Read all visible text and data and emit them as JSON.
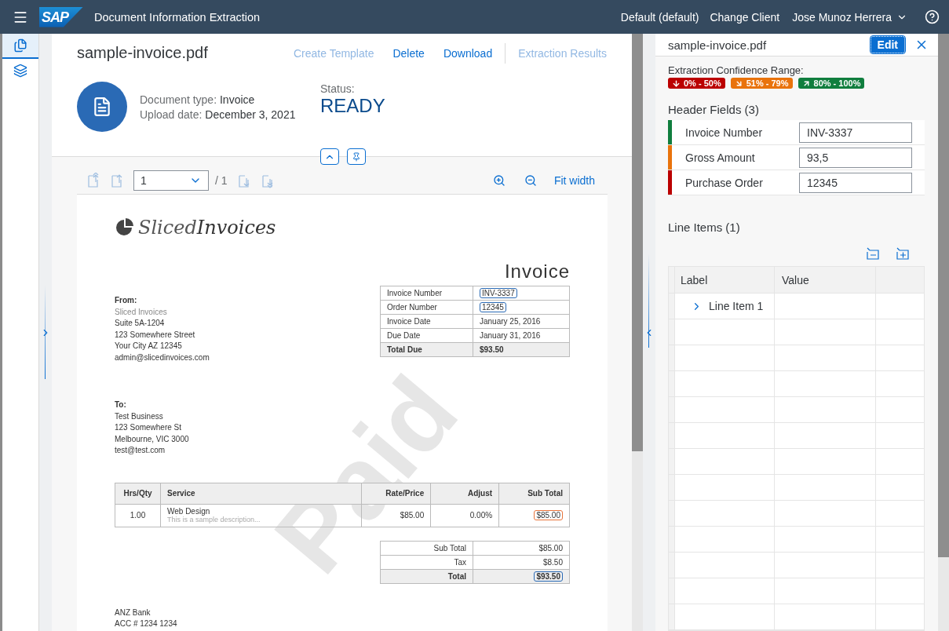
{
  "shell": {
    "logo": "SAP",
    "title": "Document Information Extraction",
    "client": "Default (default)",
    "change_client": "Change Client",
    "user": "Jose Munoz Herrera"
  },
  "rail": {
    "items": [
      {
        "kind": "documents",
        "selected": true
      },
      {
        "kind": "schemas",
        "selected": false
      }
    ]
  },
  "document": {
    "title": "sample-invoice.pdf",
    "actions": [
      {
        "label": "Create Template",
        "disabled": true
      },
      {
        "label": "Delete",
        "disabled": false
      },
      {
        "label": "Download",
        "disabled": false
      },
      {
        "label": "Extraction Results",
        "disabled": true
      }
    ],
    "doc_type_label": "Document type:",
    "doc_type": "Invoice",
    "upload_label": "Upload date:",
    "upload_date": "December 3, 2021",
    "status_label": "Status:",
    "status": "READY"
  },
  "viewer": {
    "page": "1",
    "page_count": "/ 1",
    "fit": "Fit width"
  },
  "pdf": {
    "brand_a": "Sliced",
    "brand_b": "Invoices",
    "heading": "Invoice",
    "from": {
      "label": "From:",
      "lines": [
        "Sliced Invoices",
        "Suite 5A-1204",
        "123 Somewhere Street",
        "Your City AZ 12345",
        "admin@slicedinvoices.com"
      ]
    },
    "meta": [
      {
        "label": "Invoice Number",
        "value": "INV-3337",
        "color": "#2a6ab5",
        "bold": false
      },
      {
        "label": "Order Number",
        "value": "12345",
        "color": "#2a6ab5",
        "bold": false
      },
      {
        "label": "Invoice Date",
        "value": "January 25, 2016",
        "bold": false
      },
      {
        "label": "Due Date",
        "value": "January 31, 2016",
        "bold": false
      },
      {
        "label": "Total Due",
        "value": "$93.50",
        "bold": true
      }
    ],
    "to": {
      "label": "To:",
      "lines": [
        "Test Business",
        "123 Somewhere St",
        "Melbourne, VIC 3000",
        "test@test.com"
      ]
    },
    "columns": [
      "Hrs/Qty",
      "Service",
      "Rate/Price",
      "Adjust",
      "Sub Total"
    ],
    "items": [
      {
        "qty": "1.00",
        "service": "Web Design",
        "description": "This is a sample description...",
        "rate": "$85.00",
        "adjust": "0.00%",
        "subtotal": "$85.00",
        "color": "#e8743b"
      }
    ],
    "totals": [
      {
        "label": "Sub Total",
        "value": "$85.00",
        "bold": false
      },
      {
        "label": "Tax",
        "value": "$8.50",
        "bold": false
      },
      {
        "label": "Total",
        "value": "$93.50",
        "bold": true,
        "color": "#2a6ab5"
      }
    ],
    "stamp": "Paid",
    "bank": [
      "ANZ Bank",
      "ACC # 1234 1234"
    ]
  },
  "panel": {
    "title": "sample-invoice.pdf",
    "edit": "Edit",
    "confidence_label": "Extraction Confidence Range:",
    "ranges": [
      {
        "kind": "down",
        "label": "0% - 50%",
        "color": "#bb0000"
      },
      {
        "kind": "flat",
        "label": "51% - 79%",
        "color": "#e9730c"
      },
      {
        "kind": "up",
        "label": "80% - 100%",
        "color": "#107e3e"
      }
    ],
    "header_title": "Header Fields (3)",
    "fields": [
      {
        "label": "Invoice Number",
        "value": "INV-3337",
        "color": "#107e3e"
      },
      {
        "label": "Gross Amount",
        "value": "93,5",
        "color": "#e9730c"
      },
      {
        "label": "Purchase Order",
        "value": "12345",
        "color": "#bb0000"
      }
    ],
    "line_title": "Line Items (1)",
    "columns": [
      "Label",
      "Value"
    ],
    "rows": [
      {
        "label": "Line Item 1",
        "expanded": false
      }
    ]
  }
}
